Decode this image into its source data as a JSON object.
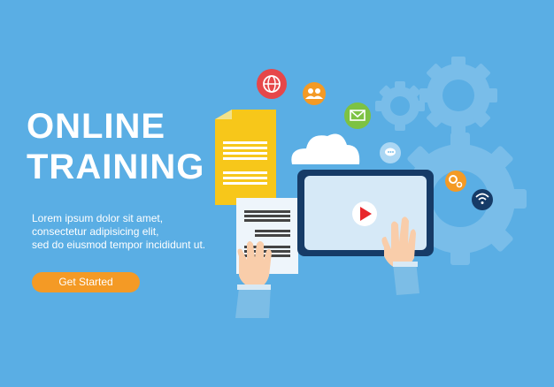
{
  "hero": {
    "title_line1": "ONLINE",
    "title_line2": "TRAINING",
    "desc_line1": "Lorem ipsum dolor sit amet,",
    "desc_line2": "consectetur adipisicing elit,",
    "desc_line3": "sed do eiusmod tempor incididunt ut.",
    "cta_label": "Get Started"
  },
  "icons": {
    "globe": "globe-icon",
    "users": "users-icon",
    "mail": "mail-icon",
    "chat": "chat-icon",
    "settings": "gear-icon",
    "wifi": "wifi-icon",
    "play": "play-icon"
  },
  "colors": {
    "background": "#5aaee4",
    "accent": "#f49a25",
    "document": "#f7c71a",
    "play": "#e8262b"
  }
}
